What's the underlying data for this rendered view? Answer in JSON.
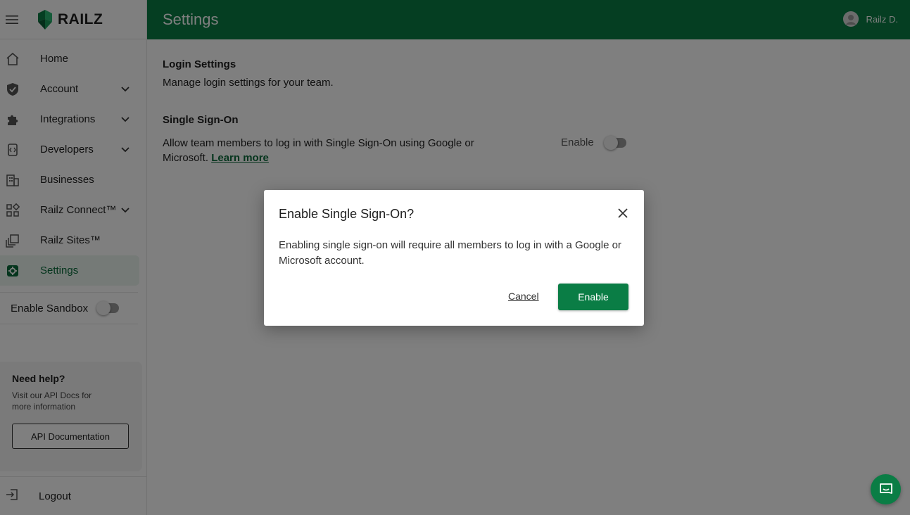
{
  "brand": {
    "name": "RAILZ"
  },
  "header": {
    "title": "Settings",
    "user_name": "Railz D."
  },
  "sidebar": {
    "items": [
      {
        "label": "Home",
        "icon": "home-icon"
      },
      {
        "label": "Account",
        "icon": "shield-icon",
        "expandable": true
      },
      {
        "label": "Integrations",
        "icon": "puzzle-icon",
        "expandable": true
      },
      {
        "label": "Developers",
        "icon": "code-icon",
        "expandable": true
      },
      {
        "label": "Businesses",
        "icon": "building-icon"
      },
      {
        "label": "Railz Connect™",
        "icon": "grid-icon",
        "expandable": true
      },
      {
        "label": "Railz Sites™",
        "icon": "pages-icon"
      },
      {
        "label": "Settings",
        "icon": "settings-icon",
        "active": true
      }
    ],
    "sandbox_label": "Enable Sandbox",
    "help": {
      "title": "Need help?",
      "text": "Visit our API Docs for more information",
      "button_label": "API Documentation"
    },
    "logout_label": "Logout"
  },
  "content": {
    "login_settings": {
      "title": "Login Settings",
      "description": "Manage login settings for your team."
    },
    "sso": {
      "title": "Single Sign-On",
      "description": "Allow team members to log in with Single Sign-On using Google or Microsoft.",
      "link_label": "Learn more",
      "toggle_label": "Enable"
    }
  },
  "modal": {
    "title": "Enable Single Sign-On?",
    "body": "Enabling single sign-on will require all members to log in with a Google or Microsoft account.",
    "cancel_label": "Cancel",
    "confirm_label": "Enable"
  },
  "colors": {
    "brand_green": "#0a7d45",
    "overlay": "rgba(0,0,0,0.5)"
  }
}
